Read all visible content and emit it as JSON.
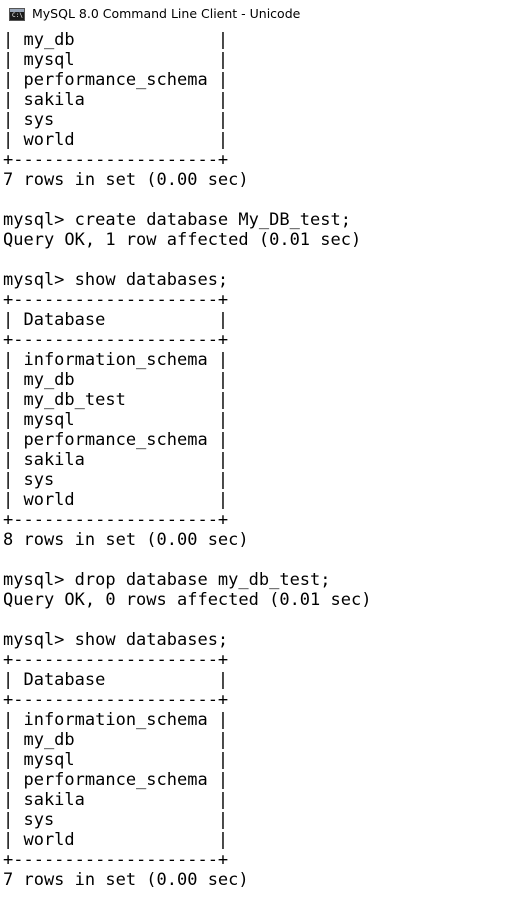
{
  "window": {
    "title": "MySQL 8.0 Command Line Client - Unicode",
    "icon": "console-window-icon"
  },
  "console": {
    "lines": [
      "| my_db              |",
      "| mysql              |",
      "| performance_schema |",
      "| sakila             |",
      "| sys                |",
      "| world              |",
      "+--------------------+",
      "7 rows in set (0.00 sec)",
      "",
      "mysql> create database My_DB_test;",
      "Query OK, 1 row affected (0.01 sec)",
      "",
      "mysql> show databases;",
      "+--------------------+",
      "| Database           |",
      "+--------------------+",
      "| information_schema |",
      "| my_db              |",
      "| my_db_test         |",
      "| mysql              |",
      "| performance_schema |",
      "| sakila             |",
      "| sys                |",
      "| world              |",
      "+--------------------+",
      "8 rows in set (0.00 sec)",
      "",
      "mysql> drop database my_db_test;",
      "Query OK, 0 rows affected (0.01 sec)",
      "",
      "mysql> show databases;",
      "+--------------------+",
      "| Database           |",
      "+--------------------+",
      "| information_schema |",
      "| my_db              |",
      "| mysql              |",
      "| performance_schema |",
      "| sakila             |",
      "| sys                |",
      "| world              |",
      "+--------------------+",
      "7 rows in set (0.00 sec)"
    ]
  }
}
